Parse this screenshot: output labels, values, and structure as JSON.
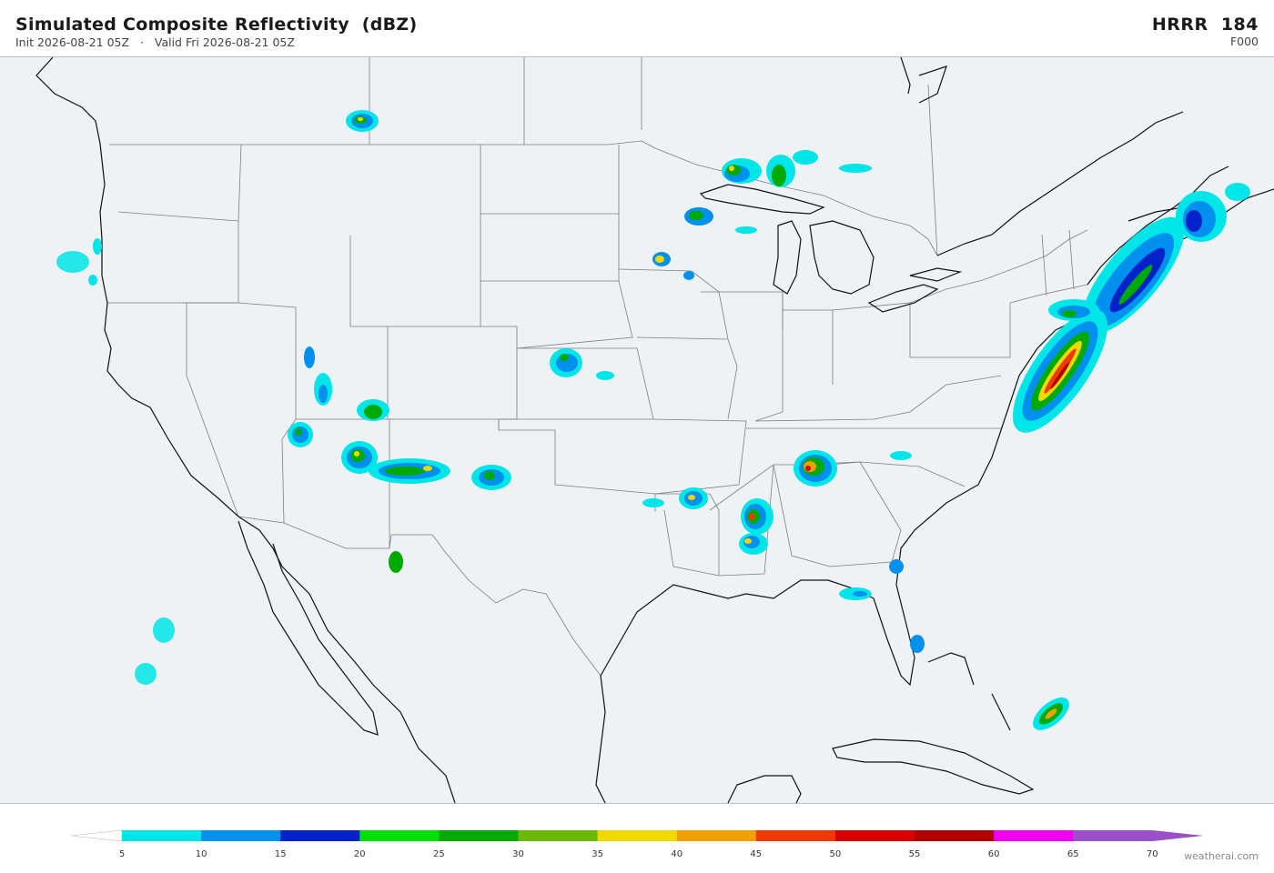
{
  "header": {
    "title": "Simulated Composite Reflectivity  (dBZ)",
    "init": "Init 2026-08-21 05Z",
    "separator": "·",
    "valid": "Valid Fri 2026-08-21 05Z",
    "model": "HRRR  184",
    "forecast_hour": "F000"
  },
  "colors": {
    "ocean": "#eef2f5",
    "land": "#eef2f5",
    "coast": "#111111",
    "border": "#7a7f85",
    "scale": [
      {
        "label": "5",
        "color": "#00e5e8"
      },
      {
        "label": "10",
        "color": "#0090ee"
      },
      {
        "label": "15",
        "color": "#0022c8"
      },
      {
        "label": "20",
        "color": "#00e000"
      },
      {
        "label": "25",
        "color": "#00aa00"
      },
      {
        "label": "30",
        "color": "#6cb800"
      },
      {
        "label": "35",
        "color": "#f0d800"
      },
      {
        "label": "40",
        "color": "#f0a000"
      },
      {
        "label": "45",
        "color": "#f03800"
      },
      {
        "label": "50",
        "color": "#d80000"
      },
      {
        "label": "55",
        "color": "#b00000"
      },
      {
        "label": "60",
        "color": "#f000f0"
      },
      {
        "label": "65",
        "color": "#9950c8"
      },
      {
        "label": "70",
        "color": ""
      }
    ],
    "overflow_color": "#9950c8"
  },
  "credit": "weatherai.com"
}
